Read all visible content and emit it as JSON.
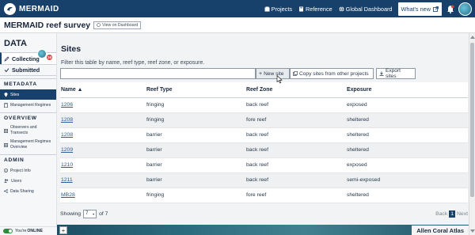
{
  "nav": {
    "brand": "MERMAID",
    "links": [
      "Projects",
      "Reference",
      "Global Dashboard"
    ],
    "whats_new": "What's new"
  },
  "project": {
    "title": "MERMAID reef survey",
    "view_dashboard": "View on Dashboard"
  },
  "sidebar": {
    "heading": "DATA",
    "tabs": {
      "collecting": "Collecting",
      "collecting_count": "16",
      "submitted": "Submitted"
    },
    "sections": {
      "metadata": "METADATA",
      "overview": "OVERVIEW",
      "admin": "ADMIN"
    },
    "items": {
      "sites": "Sites",
      "management_regimes": "Management Regimes",
      "observers_l1": "Observers and",
      "observers_l2": "Transects",
      "mr_overview_l1": "Management Regimes",
      "mr_overview_l2": "Overview",
      "project_info": "Project Info",
      "users": "Users",
      "data_sharing": "Data Sharing"
    },
    "online_prefix": "You're ",
    "online_status": "ONLINE"
  },
  "main": {
    "heading": "Sites",
    "filter_label": "Filter this table by name, reef type, reef zone, or exposure.",
    "filter_value": "",
    "buttons": {
      "new_site": "New site",
      "copy_sites": "Copy sites from other projects",
      "export_sites": "Export sites"
    },
    "table": {
      "headers": [
        "Name ▲",
        "Reef Type",
        "Reef Zone",
        "Exposure"
      ],
      "rows": [
        [
          "1206",
          "fringing",
          "back reef",
          "exposed"
        ],
        [
          "1208",
          "fringing",
          "fore reef",
          "sheltered"
        ],
        [
          "1208",
          "barrier",
          "back reef",
          "sheltered"
        ],
        [
          "1209",
          "barrier",
          "back reef",
          "sheltered"
        ],
        [
          "1210",
          "barrier",
          "back reef",
          "exposed"
        ],
        [
          "1211",
          "barrier",
          "back reef",
          "semi-exposed"
        ],
        [
          "MB28",
          "fringing",
          "fore reef",
          "sheltered"
        ]
      ]
    },
    "pager": {
      "showing": "Showing",
      "page_size": "7",
      "of_total": "of 7",
      "back": "Back",
      "current_page": "1",
      "next": "Next"
    }
  },
  "map": {
    "zoom_in": "+",
    "label": "Allen Coral Atlas"
  },
  "colors": {
    "nav_bg": "#17406b",
    "badge_red": "#d8483c",
    "online_green": "#2e8b3d"
  }
}
